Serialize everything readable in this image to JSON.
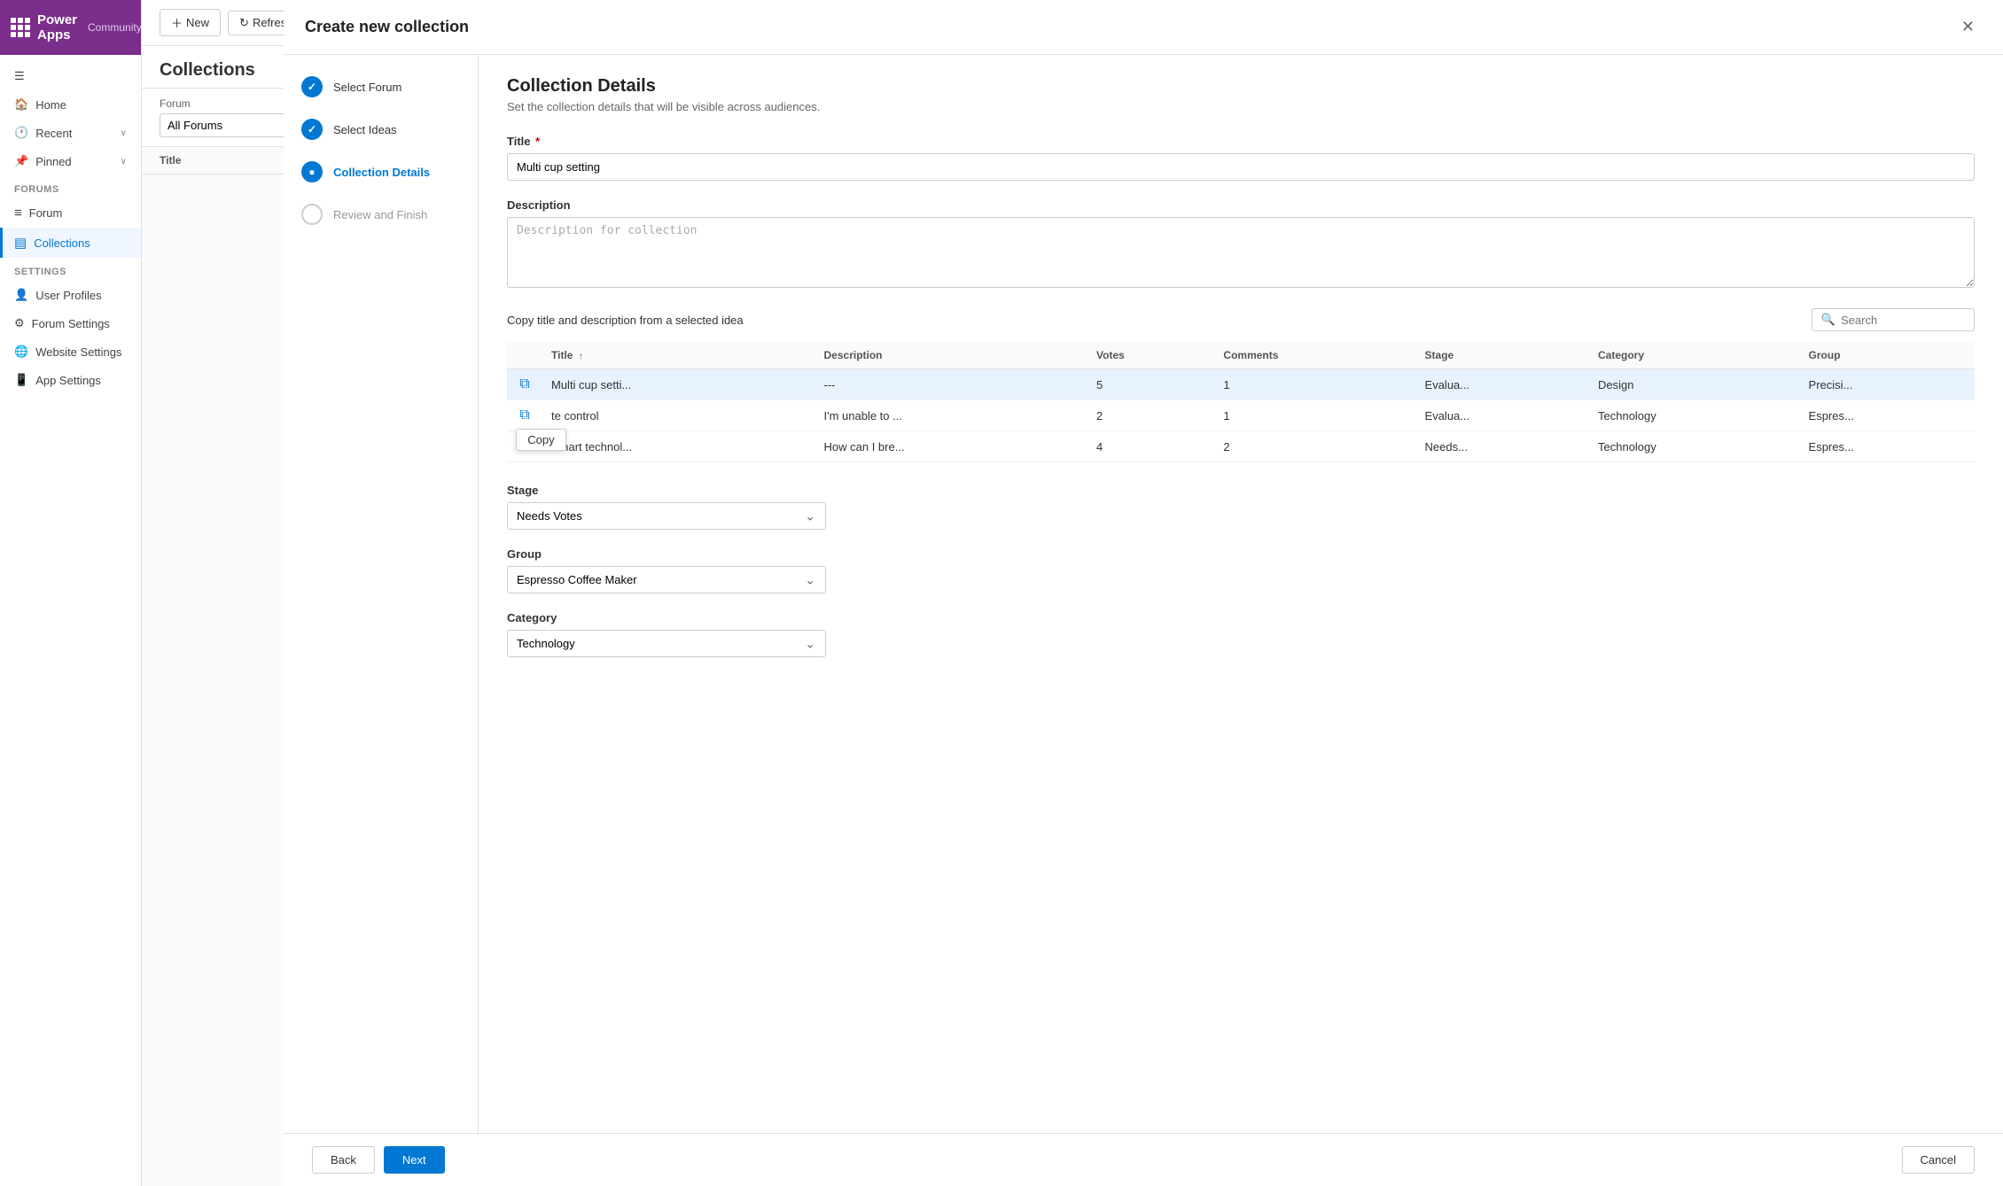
{
  "app": {
    "name": "Power Apps",
    "context": "Community"
  },
  "sidebar": {
    "nav_items": [
      {
        "id": "home",
        "label": "Home",
        "icon": "home-icon"
      },
      {
        "id": "recent",
        "label": "Recent",
        "icon": "recent-icon",
        "expandable": true
      },
      {
        "id": "pinned",
        "label": "Pinned",
        "icon": "pin-icon",
        "expandable": true
      }
    ],
    "sections": [
      {
        "label": "Forums",
        "items": [
          {
            "id": "forum",
            "label": "Forum",
            "icon": "forum-icon"
          },
          {
            "id": "collections",
            "label": "Collections",
            "icon": "collections-icon",
            "active": true
          }
        ]
      },
      {
        "label": "Settings",
        "items": [
          {
            "id": "user-profiles",
            "label": "User Profiles",
            "icon": "user-icon"
          },
          {
            "id": "forum-settings",
            "label": "Forum Settings",
            "icon": "settings-icon"
          },
          {
            "id": "website-settings",
            "label": "Website Settings",
            "icon": "website-icon"
          },
          {
            "id": "app-settings",
            "label": "App Settings",
            "icon": "app-icon"
          }
        ]
      }
    ]
  },
  "toolbar": {
    "new_label": "New",
    "refresh_label": "Refresh"
  },
  "collections": {
    "title": "Collections",
    "forum_label": "Forum",
    "forum_value": "All Forums",
    "table_col_title": "Title"
  },
  "dialog": {
    "title": "Create new collection",
    "steps": [
      {
        "id": "select-forum",
        "label": "Select Forum",
        "state": "completed"
      },
      {
        "id": "select-ideas",
        "label": "Select Ideas",
        "state": "completed"
      },
      {
        "id": "collection-details",
        "label": "Collection Details",
        "state": "active"
      },
      {
        "id": "review-finish",
        "label": "Review and Finish",
        "state": "pending"
      }
    ],
    "form": {
      "section_title": "Collection Details",
      "section_subtitle": "Set the collection details that will be visible across audiences.",
      "title_label": "Title",
      "title_required": true,
      "title_value": "Multi cup setting",
      "description_label": "Description",
      "description_placeholder": "Description for collection",
      "copy_label": "Copy title and description from a selected idea",
      "search_placeholder": "Search",
      "table": {
        "columns": [
          {
            "id": "copy",
            "label": ""
          },
          {
            "id": "title",
            "label": "Title",
            "sortable": true
          },
          {
            "id": "description",
            "label": "Description"
          },
          {
            "id": "votes",
            "label": "Votes"
          },
          {
            "id": "comments",
            "label": "Comments"
          },
          {
            "id": "stage",
            "label": "Stage"
          },
          {
            "id": "category",
            "label": "Category"
          },
          {
            "id": "group",
            "label": "Group"
          }
        ],
        "rows": [
          {
            "id": 1,
            "copy_icon": "copy-icon",
            "title": "Multi cup setti...",
            "description": "---",
            "votes": "5",
            "comments": "1",
            "stage": "Evalua...",
            "category": "Design",
            "group": "Precisi...",
            "selected": true,
            "show_copy_popup": false
          },
          {
            "id": 2,
            "copy_icon": "copy-icon",
            "title": "te control",
            "description": "I'm unable to ...",
            "votes": "2",
            "comments": "1",
            "stage": "Evalua...",
            "category": "Technology",
            "group": "Espres...",
            "selected": false,
            "show_copy_popup": true,
            "copy_popup_label": "Copy"
          },
          {
            "id": 3,
            "copy_icon": "copy-icon",
            "title": "Smart technol...",
            "description": "How can I bre...",
            "votes": "4",
            "comments": "2",
            "stage": "Needs...",
            "category": "Technology",
            "group": "Espres...",
            "selected": false,
            "show_copy_popup": false
          }
        ]
      },
      "stage_label": "Stage",
      "stage_value": "Needs Votes",
      "group_label": "Group",
      "group_value": "Espresso Coffee Maker",
      "category_label": "Category",
      "category_value": "Technology"
    },
    "footer": {
      "back_label": "Back",
      "next_label": "Next",
      "cancel_label": "Cancel"
    }
  }
}
